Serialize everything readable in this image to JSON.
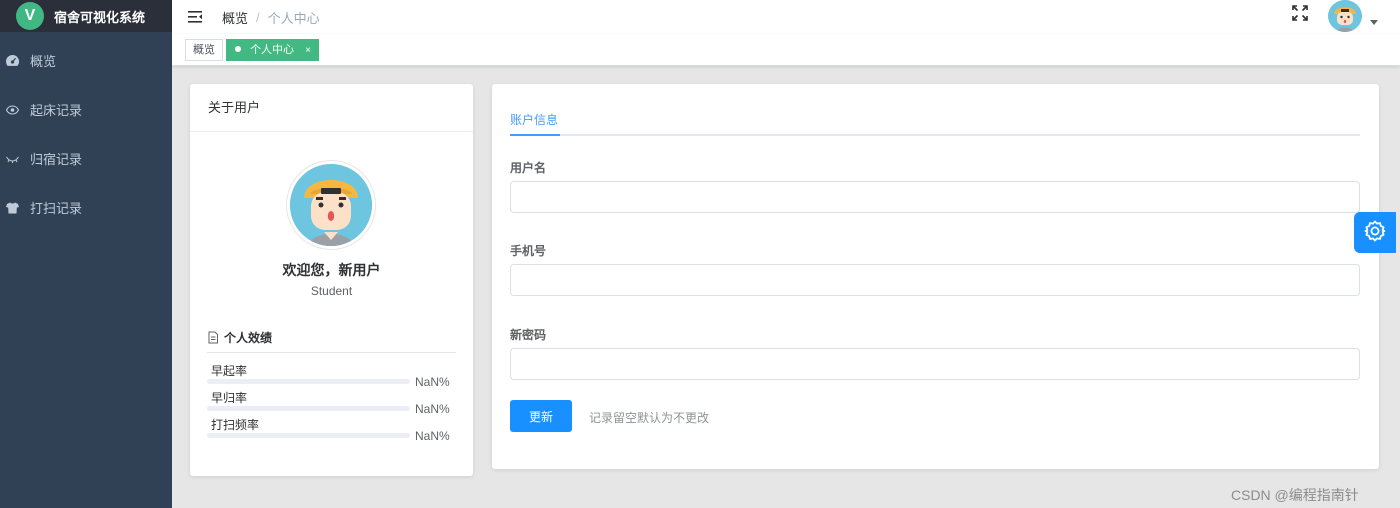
{
  "app": {
    "title": "宿舍可视化系统",
    "logo_letter": "V"
  },
  "sidebar": {
    "items": [
      {
        "label": "概览",
        "icon": "dashboard-icon"
      },
      {
        "label": "起床记录",
        "icon": "eye-icon"
      },
      {
        "label": "归宿记录",
        "icon": "eye-closed-icon"
      },
      {
        "label": "打扫记录",
        "icon": "shirt-icon"
      }
    ]
  },
  "navbar": {
    "breadcrumb": [
      "概览",
      "个人中心"
    ]
  },
  "tags": [
    {
      "label": "概览",
      "active": false
    },
    {
      "label": "个人中心",
      "active": true,
      "close": "×"
    }
  ],
  "user_card": {
    "header": "关于用户",
    "welcome": "欢迎您，新用户",
    "role": "Student",
    "performance_title": "个人效绩",
    "stats": [
      {
        "label": "早起率",
        "value_text": "NaN%",
        "fill_percent": 0
      },
      {
        "label": "早归率",
        "value_text": "NaN%",
        "fill_percent": 0
      },
      {
        "label": "打扫频率",
        "value_text": "NaN%",
        "fill_percent": 0
      }
    ]
  },
  "account": {
    "tab_label": "账户信息",
    "fields": [
      {
        "label": "用户名",
        "value": "",
        "placeholder": ""
      },
      {
        "label": "手机号",
        "value": "",
        "placeholder": ""
      },
      {
        "label": "新密码",
        "value": "",
        "placeholder": ""
      }
    ],
    "submit_label": "更新",
    "hint": "记录留空默认为不更改"
  },
  "watermark": "CSDN @编程指南针",
  "colors": {
    "sidebar_bg": "#304156",
    "accent": "#1890ff",
    "tag_active": "#42b983"
  }
}
